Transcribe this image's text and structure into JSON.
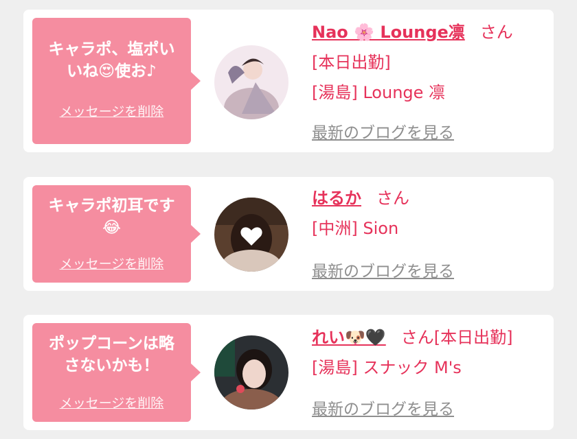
{
  "colors": {
    "background": "#efefef",
    "card": "#ffffff",
    "bubble": "#f58da0",
    "accent_text": "#e6325a",
    "link_gray": "#8e8e8e"
  },
  "cards": [
    {
      "message_lines": [
        "キャラポ、塩ポい",
        "いね😍使お♪"
      ],
      "delete_label": "メッセージを削除",
      "name": "Nao 🌸 Lounge凛",
      "honorific": "さん",
      "lines": [
        "[本日出勤]",
        "[湯島] Lounge 凛"
      ],
      "blog_label": "最新のブログを見る"
    },
    {
      "message_lines": [
        "キャラポ初耳です",
        "😂"
      ],
      "delete_label": "メッセージを削除",
      "name": "はるか",
      "honorific": "さん",
      "lines": [
        "[中洲] Sion"
      ],
      "blog_label": "最新のブログを見る"
    },
    {
      "message_lines": [
        "ポップコーンは略",
        "さないかも！"
      ],
      "delete_label": "メッセージを削除",
      "name": "れい🐶🖤",
      "honorific": "さん[本日出勤]",
      "lines": [
        "[湯島] スナック M's"
      ],
      "blog_label": "最新のブログを見る"
    }
  ]
}
